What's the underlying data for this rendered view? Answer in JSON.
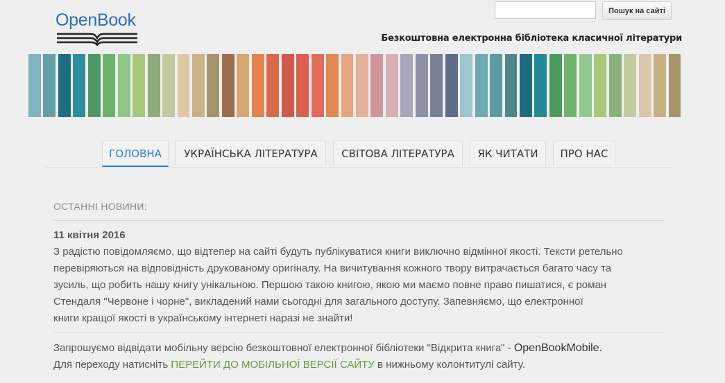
{
  "header": {
    "logo_text": "OpenBook",
    "search": {
      "value": "",
      "placeholder": ""
    },
    "search_button_label": "Пошук на сайті",
    "tagline": "Безкоштовна електронна бібліотека класичної літератури"
  },
  "banner": {
    "stripe_colors": [
      "#7fb3bd",
      "#62a0a8",
      "#1e6f80",
      "#2d8e9e",
      "#4e9a66",
      "#6cb26a",
      "#8ec786",
      "#a9c77a",
      "#8faa78",
      "#c3c99f",
      "#ddc8a4",
      "#c9b288",
      "#a5926a",
      "#9b6f4e",
      "#d6a66e",
      "#e6824f",
      "#d86a4a",
      "#cf5a48",
      "#dc5f50",
      "#e36b59",
      "#e3874f",
      "#e6a57f",
      "#e3b196",
      "#cf959a",
      "#d7b1b6",
      "#a9a5b9",
      "#8d91a6",
      "#788295",
      "#5e6e88",
      "#9dc6cc",
      "#6eaab1",
      "#5d9ba3",
      "#52868a",
      "#1c6d7f",
      "#238b97",
      "#4a9c5e",
      "#71b470",
      "#91c98f",
      "#a8c97a",
      "#8bb27b",
      "#c1cba2",
      "#dac7a9",
      "#c8b085",
      "#a6946d"
    ]
  },
  "nav": {
    "tabs": [
      {
        "label": "ГОЛОВНА"
      },
      {
        "label": "УКРАЇНСЬКА ЛІТЕРАТУРА"
      },
      {
        "label": "СВІТОВА ЛІТЕРАТУРА"
      },
      {
        "label": "ЯК ЧИТАТИ"
      },
      {
        "label": "ПРО НАС"
      }
    ],
    "active_color": "#2a7fbf"
  },
  "news": {
    "heading": "ОСТАННІ НОВИНИ:",
    "date": "11 квітня 2016",
    "lines": [
      "З радістю повідомляємо, що відтепер на сайті будуть публікуватися книги виключно відмінної якості. Тексти ретельно",
      "перевіряються на відповідність друкованому оригіналу. На вичитування кожного твору витрачається багато часу та",
      "зусиль, що робить нашу книгу унікальною. Першою такою книгою, якою ми маємо повне право пишатися, є роман",
      "Стендаля \"Червоне і чорне\", викладений нами сьогодні для загального доступу. Запевняємо, що електронної",
      "книги кращої якості в українському інтернеті наразі не знайти!"
    ]
  },
  "mobile": {
    "line1_prefix": "Запрошуємо відвідати мобільну версію безкоштовної електронної бібліотеки \"Відкрита книга\" - ",
    "brand": "OpenBookMobile.",
    "line2_prefix": "Для переходу натисніть ",
    "link_label": "ПЕРЕЙТИ ДО МОБІЛЬНОЇ ВЕРСІЇ САЙТУ",
    "line2_suffix": " в нижньому колонтитулі сайту.",
    "link_color": "#5a9e3a"
  }
}
